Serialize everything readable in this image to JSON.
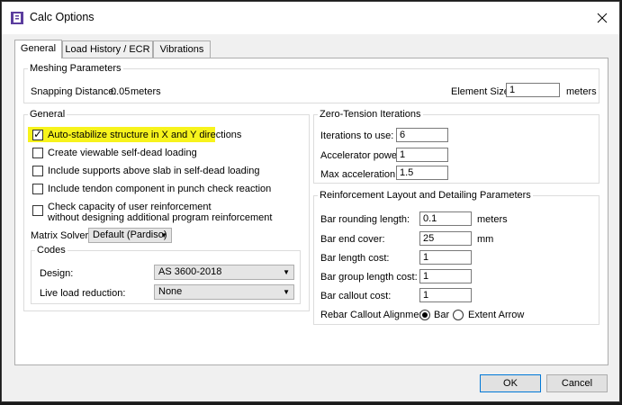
{
  "window": {
    "title": "Calc Options",
    "colors": {
      "highlight": "#f7f31c",
      "default_button_border": "#0078d7"
    }
  },
  "tabs": [
    {
      "label": "General",
      "active": true
    },
    {
      "label": "Load History / ECR",
      "active": false
    },
    {
      "label": "Vibrations",
      "active": false
    }
  ],
  "meshing": {
    "title": "Meshing Parameters",
    "snapping_label": "Snapping Distance:",
    "snapping_value": "0.05",
    "snapping_unit": "meters",
    "element_size_label": "Element Size:",
    "element_size_value": "1",
    "element_size_unit": "meters"
  },
  "general": {
    "title": "General",
    "checkboxes": [
      {
        "label": "Auto-stabilize structure in X and Y directions",
        "checked": true
      },
      {
        "label": "Create viewable self-dead loading",
        "checked": false
      },
      {
        "label": "Include supports above slab in self-dead loading",
        "checked": false
      },
      {
        "label": "Include tendon component in punch check reaction",
        "checked": false
      },
      {
        "label_line1": "Check capacity of user reinforcement",
        "label_line2": "without designing additional program reinforcement",
        "checked": false
      }
    ],
    "matrix_solver_label": "Matrix Solver:",
    "matrix_solver_value": "Default (Pardiso)",
    "codes": {
      "title": "Codes",
      "design_label": "Design:",
      "design_value": "AS 3600-2018",
      "live_load_label": "Live load reduction:",
      "live_load_value": "None"
    }
  },
  "zero_tension": {
    "title": "Zero-Tension Iterations",
    "iterations_label": "Iterations to use:",
    "iterations_value": "6",
    "accelerator_label": "Accelerator power:",
    "accelerator_value": "1",
    "max_accel_label": "Max acceleration:",
    "max_accel_value": "1.5"
  },
  "reinforcement": {
    "title": "Reinforcement Layout and Detailing Parameters",
    "bar_rounding_label": "Bar rounding length:",
    "bar_rounding_value": "0.1",
    "bar_rounding_unit": "meters",
    "bar_end_cover_label": "Bar end cover:",
    "bar_end_cover_value": "25",
    "bar_end_cover_unit": "mm",
    "bar_length_cost_label": "Bar length cost:",
    "bar_length_cost_value": "1",
    "bar_group_cost_label": "Bar group length cost:",
    "bar_group_cost_value": "1",
    "bar_callout_cost_label": "Bar callout cost:",
    "bar_callout_cost_value": "1",
    "alignment_label": "Rebar Callout Alignment:",
    "alignment_options": [
      {
        "label": "Bar",
        "selected": true
      },
      {
        "label": "Extent Arrow",
        "selected": false
      }
    ]
  },
  "buttons": {
    "ok": "OK",
    "cancel": "Cancel"
  }
}
